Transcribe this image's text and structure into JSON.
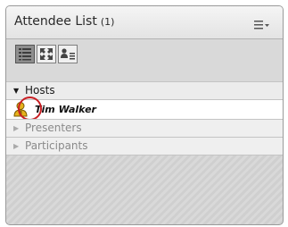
{
  "pod": {
    "title": "Attendee List",
    "count": "(1)",
    "menu_icon": "pod-menu-icon"
  },
  "toolbar": {
    "buttons": [
      {
        "name": "list-view",
        "icon": "list-view-icon",
        "active": true
      },
      {
        "name": "expand-view",
        "icon": "expand-icon",
        "active": false
      },
      {
        "name": "status-view",
        "icon": "attendee-status-icon",
        "active": false
      }
    ]
  },
  "sections": {
    "hosts": {
      "label": "Hosts",
      "expanded": true
    },
    "presenters": {
      "label": "Presenters",
      "expanded": false
    },
    "participants": {
      "label": "Participants",
      "expanded": false
    }
  },
  "hosts": [
    {
      "name": "Tim Walker",
      "icon": "host-user-icon",
      "highlighted": true
    }
  ],
  "colors": {
    "highlight": "#c91f24",
    "host_icon": "#e6b21c"
  },
  "glyphs": {
    "expanded_arrow": "▼",
    "collapsed_arrow": "▶"
  }
}
